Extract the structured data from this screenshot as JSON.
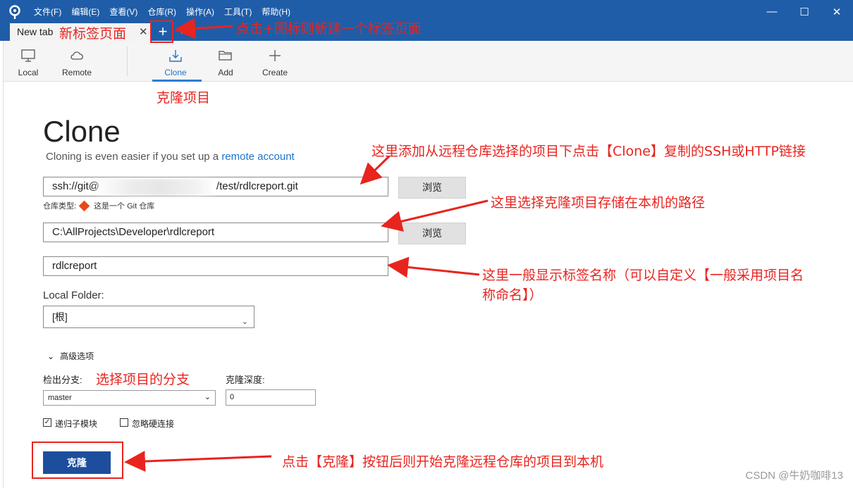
{
  "menu": [
    "文件(F)",
    "编辑(E)",
    "查看(V)",
    "仓库(R)",
    "操作(A)",
    "工具(T)",
    "帮助(H)"
  ],
  "window_controls": {
    "minimize": "—",
    "maximize": "☐",
    "close": "✕"
  },
  "tab": {
    "title": "New tab",
    "close": "✕",
    "add": "+",
    "dropdown": "▼"
  },
  "toolbar": [
    {
      "label": "Local",
      "icon": "monitor-icon"
    },
    {
      "label": "Remote",
      "icon": "cloud-icon"
    },
    {
      "label": "Clone",
      "icon": "download-icon",
      "active": true
    },
    {
      "label": "Add",
      "icon": "folder-icon"
    },
    {
      "label": "Create",
      "icon": "plus-icon"
    }
  ],
  "clone": {
    "heading": "Clone",
    "subtitle_prefix": "Cloning is even easier if you set up a ",
    "subtitle_link": "remote account",
    "url_prefix": "ssh://git@",
    "url_suffix": "/test/rdlcreport.git",
    "browse": "浏览",
    "repo_type_label": "仓库类型:",
    "repo_type_value": "这是一个 Git 仓库",
    "path": "C:\\AllProjects\\Developer\\rdlcreport",
    "name": "rdlcreport",
    "local_folder_label": "Local Folder:",
    "local_folder_value": "[根]",
    "advanced": "高级选项",
    "branch_label": "检出分支:",
    "branch_value": "master",
    "depth_label": "克隆深度:",
    "depth_value": "0",
    "recursive_label": "递归子模块",
    "recursive_checked": true,
    "ignore_hardlinks_label": "忽略硬连接",
    "ignore_hardlinks_checked": false,
    "clone_button": "克隆"
  },
  "annotations": {
    "new_tab": "新标签页面",
    "plus_hint": "点击+图标则新建一个标签页面",
    "clone_project": "克隆项目",
    "url_hint": "这里添加从远程仓库选择的项目下点击【Clone】复制的SSH或HTTP链接",
    "path_hint": "这里选择克隆项目存储在本机的路径",
    "name_hint_1": "这里一般显示标签名称（可以自定义【一般采用项目名",
    "name_hint_2": "称命名】）",
    "branch_hint": "选择项目的分支",
    "clone_hint": "点击【克隆】按钮后则开始克隆远程仓库的项目到本机"
  },
  "watermark": "CSDN @牛奶咖啡13",
  "colors": {
    "titlebar": "#1F5DA8",
    "accent": "#1F73C8",
    "annotation": "#E8241F",
    "clone_button": "#1D4E9E"
  }
}
